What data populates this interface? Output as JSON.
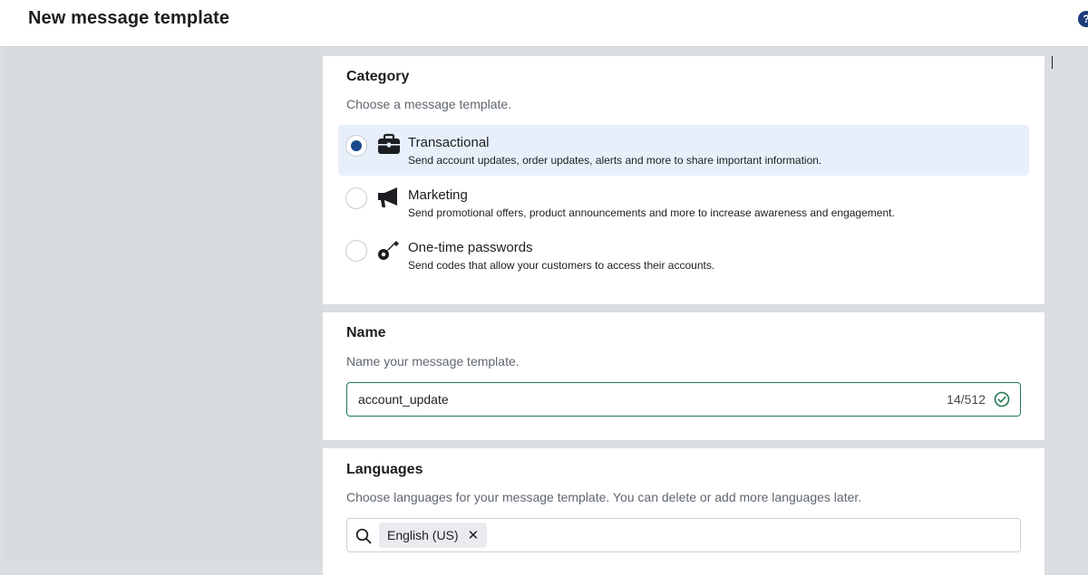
{
  "header": {
    "title": "New message template",
    "help_icon": "?"
  },
  "category": {
    "title": "Category",
    "subtitle": "Choose a message template.",
    "options": [
      {
        "icon": "briefcase-icon",
        "label": "Transactional",
        "description": "Send account updates, order updates, alerts and more to share important information.",
        "selected": true
      },
      {
        "icon": "megaphone-icon",
        "label": "Marketing",
        "description": "Send promotional offers, product announcements and more to increase awareness and engagement.",
        "selected": false
      },
      {
        "icon": "key-icon",
        "label": "One-time passwords",
        "description": "Send codes that allow your customers to access their accounts.",
        "selected": false
      }
    ]
  },
  "name": {
    "title": "Name",
    "subtitle": "Name your message template.",
    "value": "account_update",
    "counter": "14/512"
  },
  "languages": {
    "title": "Languages",
    "subtitle": "Choose languages for your message template. You can delete or add more languages later.",
    "selected": [
      "English (US)"
    ],
    "remove_glyph": "✕"
  },
  "colors": {
    "accent": "#1a4a8c",
    "selected_bg": "#e7f0fa",
    "valid_border": "#1f7a52"
  }
}
